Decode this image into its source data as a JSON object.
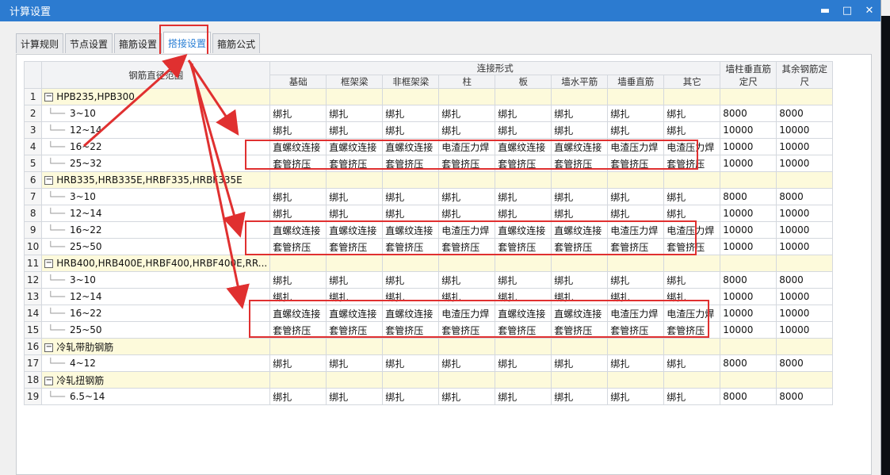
{
  "window": {
    "title": "计算设置",
    "minimize": "▬",
    "maximize": "□",
    "close": "✕"
  },
  "tabs": [
    {
      "label": "计算规则"
    },
    {
      "label": "节点设置"
    },
    {
      "label": "箍筋设置"
    },
    {
      "label": "搭接设置"
    },
    {
      "label": "箍筋公式"
    }
  ],
  "active_tab": 3,
  "table": {
    "header_range": "钢筋直径范围",
    "header_group": "连接形式",
    "connect_cols": [
      "基础",
      "框架梁",
      "非框架梁",
      "柱",
      "板",
      "墙水平筋",
      "墙垂直筋",
      "其它"
    ],
    "header_wall_len": "墙柱垂直筋定尺",
    "header_other_len": "其余钢筋定尺",
    "rows": [
      {
        "n": "1",
        "group": true,
        "label": "HPB235,HPB300"
      },
      {
        "n": "2",
        "label": "3~10",
        "cells": [
          "绑扎",
          "绑扎",
          "绑扎",
          "绑扎",
          "绑扎",
          "绑扎",
          "绑扎",
          "绑扎"
        ],
        "len1": "8000",
        "len2": "8000"
      },
      {
        "n": "3",
        "label": "12~14",
        "cells": [
          "绑扎",
          "绑扎",
          "绑扎",
          "绑扎",
          "绑扎",
          "绑扎",
          "绑扎",
          "绑扎"
        ],
        "len1": "10000",
        "len2": "10000"
      },
      {
        "n": "4",
        "label": "16~22",
        "cells": [
          "直螺纹连接",
          "直螺纹连接",
          "直螺纹连接",
          "电渣压力焊",
          "直螺纹连接",
          "直螺纹连接",
          "电渣压力焊",
          "电渣压力焊"
        ],
        "len1": "10000",
        "len2": "10000"
      },
      {
        "n": "5",
        "label": "25~32",
        "cells": [
          "套管挤压",
          "套管挤压",
          "套管挤压",
          "套管挤压",
          "套管挤压",
          "套管挤压",
          "套管挤压",
          "套管挤压"
        ],
        "len1": "10000",
        "len2": "10000"
      },
      {
        "n": "6",
        "group": true,
        "label": "HRB335,HRB335E,HRBF335,HRBF335E"
      },
      {
        "n": "7",
        "label": "3~10",
        "cells": [
          "绑扎",
          "绑扎",
          "绑扎",
          "绑扎",
          "绑扎",
          "绑扎",
          "绑扎",
          "绑扎"
        ],
        "len1": "8000",
        "len2": "8000"
      },
      {
        "n": "8",
        "label": "12~14",
        "cells": [
          "绑扎",
          "绑扎",
          "绑扎",
          "绑扎",
          "绑扎",
          "绑扎",
          "绑扎",
          "绑扎"
        ],
        "len1": "10000",
        "len2": "10000"
      },
      {
        "n": "9",
        "label": "16~22",
        "cells": [
          "直螺纹连接",
          "直螺纹连接",
          "直螺纹连接",
          "电渣压力焊",
          "直螺纹连接",
          "直螺纹连接",
          "电渣压力焊",
          "电渣压力焊"
        ],
        "len1": "10000",
        "len2": "10000"
      },
      {
        "n": "10",
        "label": "25~50",
        "cells": [
          "套管挤压",
          "套管挤压",
          "套管挤压",
          "套管挤压",
          "套管挤压",
          "套管挤压",
          "套管挤压",
          "套管挤压"
        ],
        "len1": "10000",
        "len2": "10000"
      },
      {
        "n": "11",
        "group": true,
        "label": "HRB400,HRB400E,HRBF400,HRBF400E,RR..."
      },
      {
        "n": "12",
        "label": "3~10",
        "cells": [
          "绑扎",
          "绑扎",
          "绑扎",
          "绑扎",
          "绑扎",
          "绑扎",
          "绑扎",
          "绑扎"
        ],
        "len1": "8000",
        "len2": "8000"
      },
      {
        "n": "13",
        "label": "12~14",
        "cells": [
          "绑扎",
          "绑扎",
          "绑扎",
          "绑扎",
          "绑扎",
          "绑扎",
          "绑扎",
          "绑扎"
        ],
        "len1": "10000",
        "len2": "10000"
      },
      {
        "n": "14",
        "label": "16~22",
        "cells": [
          "直螺纹连接",
          "直螺纹连接",
          "直螺纹连接",
          "电渣压力焊",
          "直螺纹连接",
          "直螺纹连接",
          "电渣压力焊",
          "电渣压力焊"
        ],
        "len1": "10000",
        "len2": "10000"
      },
      {
        "n": "15",
        "label": "25~50",
        "cells": [
          "套管挤压",
          "套管挤压",
          "套管挤压",
          "套管挤压",
          "套管挤压",
          "套管挤压",
          "套管挤压",
          "套管挤压"
        ],
        "len1": "10000",
        "len2": "10000"
      },
      {
        "n": "16",
        "group": true,
        "label": "冷轧带肋钢筋"
      },
      {
        "n": "17",
        "label": "4~12",
        "cells": [
          "绑扎",
          "绑扎",
          "绑扎",
          "绑扎",
          "绑扎",
          "绑扎",
          "绑扎",
          "绑扎"
        ],
        "len1": "8000",
        "len2": "8000"
      },
      {
        "n": "18",
        "group": true,
        "label": "冷轧扭钢筋"
      },
      {
        "n": "19",
        "label": "6.5~14",
        "cells": [
          "绑扎",
          "绑扎",
          "绑扎",
          "绑扎",
          "绑扎",
          "绑扎",
          "绑扎",
          "绑扎"
        ],
        "len1": "8000",
        "len2": "8000"
      }
    ]
  },
  "colors": {
    "titlebar": "#2c7bd0",
    "annotation": "#e03030",
    "group_row": "#fdfadb"
  }
}
